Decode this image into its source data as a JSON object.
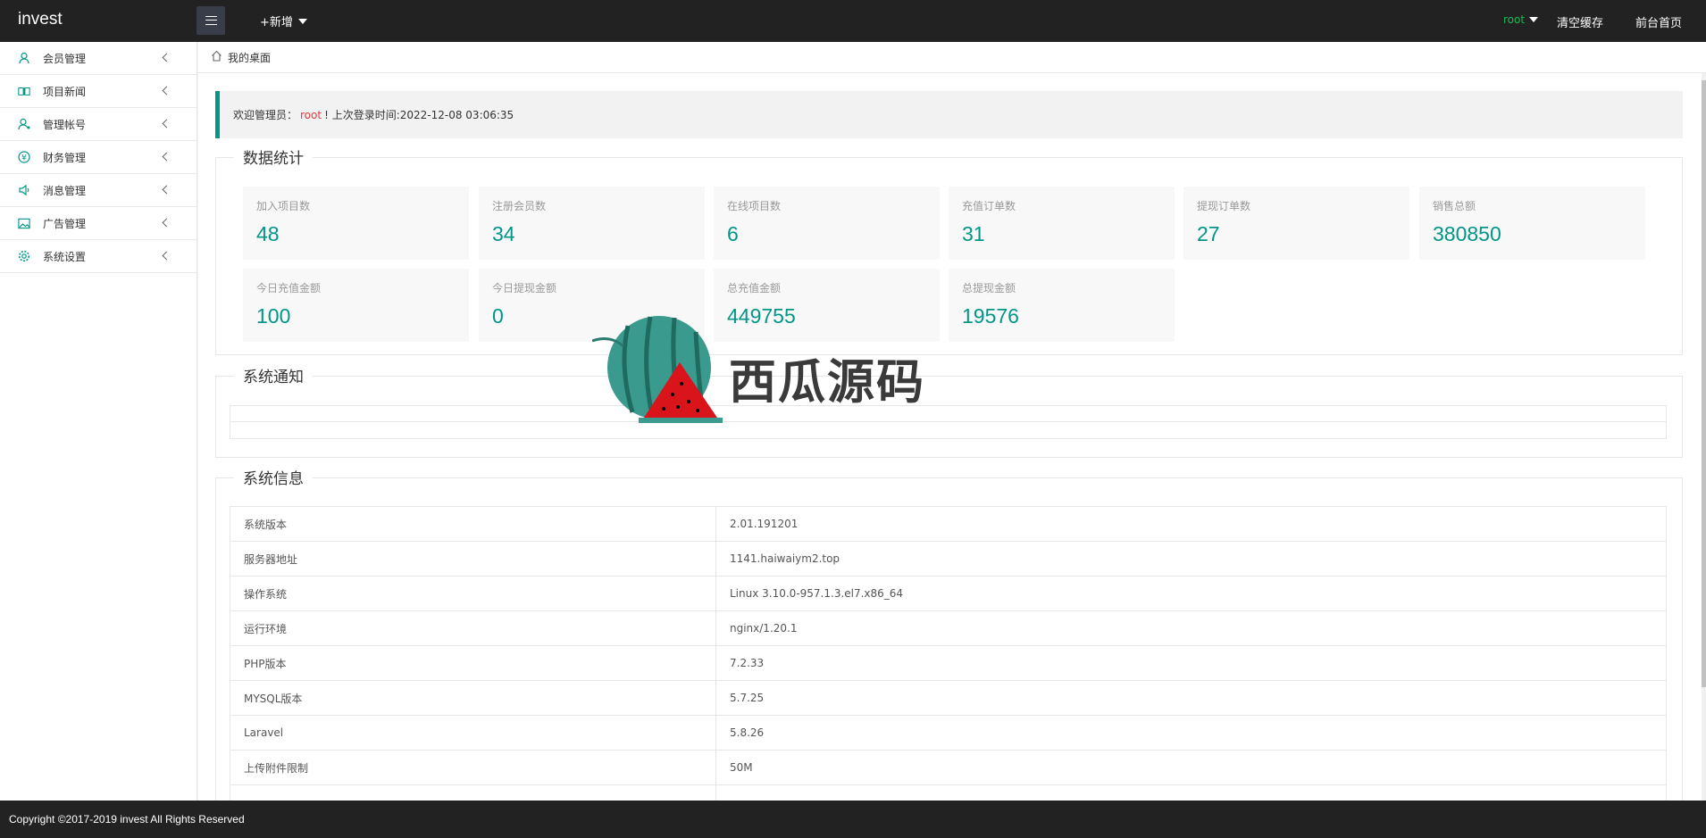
{
  "header": {
    "logo": "invest",
    "add_new": "+新增",
    "user": "root",
    "clear_cache": "清空缓存",
    "front_home": "前台首页"
  },
  "sidebar": {
    "items": [
      {
        "label": "会员管理",
        "icon": "user-icon"
      },
      {
        "label": "项目新闻",
        "icon": "book-icon"
      },
      {
        "label": "管理帐号",
        "icon": "admin-user-icon"
      },
      {
        "label": "财务管理",
        "icon": "finance-icon"
      },
      {
        "label": "消息管理",
        "icon": "speaker-icon"
      },
      {
        "label": "广告管理",
        "icon": "image-icon"
      },
      {
        "label": "系统设置",
        "icon": "gear-icon"
      }
    ]
  },
  "breadcrumb": {
    "label": "我的桌面",
    "icon": "home-icon"
  },
  "welcome": {
    "prefix": "欢迎管理员：",
    "user": "root",
    "suffix": "! 上次登录时间:2022-12-08 03:06:35"
  },
  "stats": {
    "title": "数据统计",
    "items": [
      {
        "label": "加入项目数",
        "value": "48"
      },
      {
        "label": "注册会员数",
        "value": "34"
      },
      {
        "label": "在线项目数",
        "value": "6"
      },
      {
        "label": "充值订单数",
        "value": "31"
      },
      {
        "label": "提现订单数",
        "value": "27"
      },
      {
        "label": "销售总额",
        "value": "380850"
      },
      {
        "label": "今日充值金额",
        "value": "100"
      },
      {
        "label": "今日提现金额",
        "value": "0"
      },
      {
        "label": "总充值金额",
        "value": "449755"
      },
      {
        "label": "总提现金额",
        "value": "19576"
      }
    ]
  },
  "notice": {
    "title": "系统通知"
  },
  "sysinfo": {
    "title": "系统信息",
    "rows": [
      {
        "k": "系统版本",
        "v": "2.01.191201"
      },
      {
        "k": "服务器地址",
        "v": "1141.haiwaiym2.top"
      },
      {
        "k": "操作系统",
        "v": "Linux 3.10.0-957.1.3.el7.x86_64"
      },
      {
        "k": "运行环境",
        "v": "nginx/1.20.1"
      },
      {
        "k": "PHP版本",
        "v": "7.2.33"
      },
      {
        "k": "MYSQL版本",
        "v": "5.7.25"
      },
      {
        "k": "Laravel",
        "v": "5.8.26"
      },
      {
        "k": "上传附件限制",
        "v": "50M"
      }
    ]
  },
  "watermark": {
    "text": "西瓜源码"
  },
  "footer": {
    "copyright": "Copyright ©2017-2019 invest All Rights Reserved"
  },
  "colors": {
    "accent": "#009688",
    "header_bg": "#222222",
    "user_green": "#19b955",
    "welcome_user": "#e4393c"
  }
}
